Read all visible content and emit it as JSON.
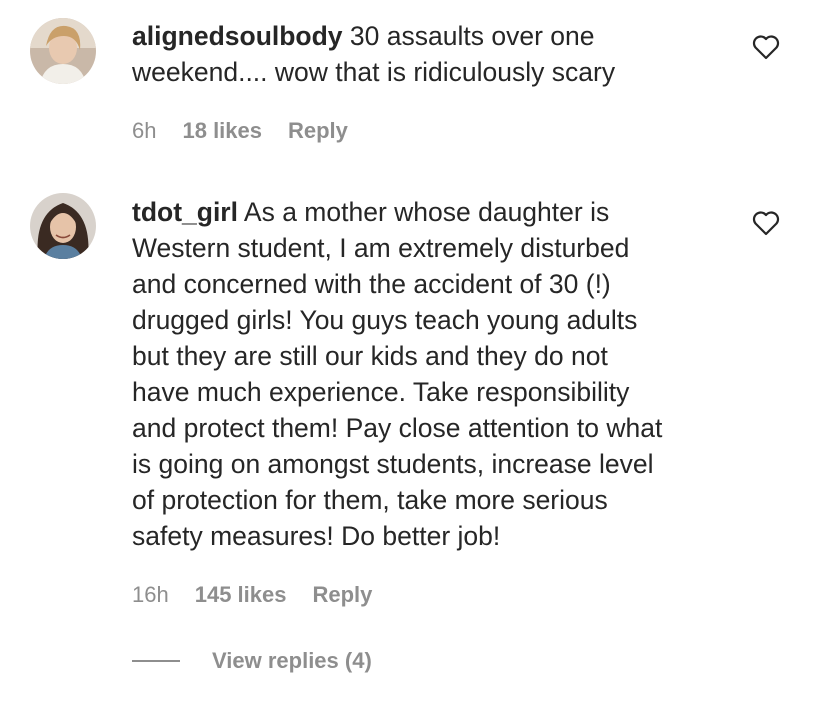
{
  "comments": [
    {
      "username": "alignedsoulbody",
      "text": "30 assaults over one\nweekend.... wow that is ridiculously scary",
      "time": "6h",
      "likes": "18 likes",
      "reply_label": "Reply"
    },
    {
      "username": "tdot_girl",
      "text": "As a mother whose daughter is\nWestern student, I am extremely disturbed\nand concerned with the accident of 30 (!)\ndrugged girls! You guys teach young adults\nbut they are still our kids and they do not\nhave much experience. Take responsibility\nand protect them! Pay close attention to what\nis going on amongst students, increase level\nof protection for them, take more serious\nsafety measures! Do better job!",
      "time": "16h",
      "likes": "145 likes",
      "reply_label": "Reply"
    }
  ],
  "view_replies_label": "View replies (4)",
  "icons": {
    "like": "heart-outline-icon"
  },
  "colors": {
    "text": "#262626",
    "muted": "#8e8e8e",
    "background": "#ffffff"
  }
}
